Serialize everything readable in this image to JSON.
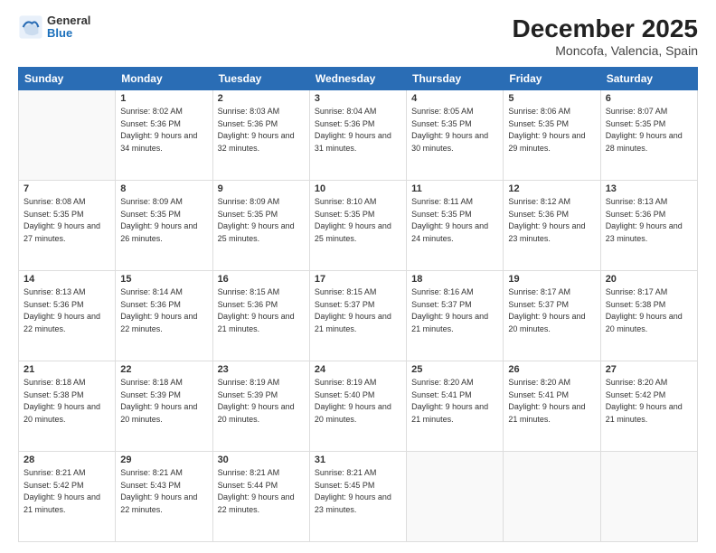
{
  "logo": {
    "general": "General",
    "blue": "Blue"
  },
  "title": "December 2025",
  "subtitle": "Moncofa, Valencia, Spain",
  "days_header": [
    "Sunday",
    "Monday",
    "Tuesday",
    "Wednesday",
    "Thursday",
    "Friday",
    "Saturday"
  ],
  "weeks": [
    [
      {
        "day": "",
        "sunrise": "",
        "sunset": "",
        "daylight": ""
      },
      {
        "day": "1",
        "sunrise": "Sunrise: 8:02 AM",
        "sunset": "Sunset: 5:36 PM",
        "daylight": "Daylight: 9 hours and 34 minutes."
      },
      {
        "day": "2",
        "sunrise": "Sunrise: 8:03 AM",
        "sunset": "Sunset: 5:36 PM",
        "daylight": "Daylight: 9 hours and 32 minutes."
      },
      {
        "day": "3",
        "sunrise": "Sunrise: 8:04 AM",
        "sunset": "Sunset: 5:36 PM",
        "daylight": "Daylight: 9 hours and 31 minutes."
      },
      {
        "day": "4",
        "sunrise": "Sunrise: 8:05 AM",
        "sunset": "Sunset: 5:35 PM",
        "daylight": "Daylight: 9 hours and 30 minutes."
      },
      {
        "day": "5",
        "sunrise": "Sunrise: 8:06 AM",
        "sunset": "Sunset: 5:35 PM",
        "daylight": "Daylight: 9 hours and 29 minutes."
      },
      {
        "day": "6",
        "sunrise": "Sunrise: 8:07 AM",
        "sunset": "Sunset: 5:35 PM",
        "daylight": "Daylight: 9 hours and 28 minutes."
      }
    ],
    [
      {
        "day": "7",
        "sunrise": "Sunrise: 8:08 AM",
        "sunset": "Sunset: 5:35 PM",
        "daylight": "Daylight: 9 hours and 27 minutes."
      },
      {
        "day": "8",
        "sunrise": "Sunrise: 8:09 AM",
        "sunset": "Sunset: 5:35 PM",
        "daylight": "Daylight: 9 hours and 26 minutes."
      },
      {
        "day": "9",
        "sunrise": "Sunrise: 8:09 AM",
        "sunset": "Sunset: 5:35 PM",
        "daylight": "Daylight: 9 hours and 25 minutes."
      },
      {
        "day": "10",
        "sunrise": "Sunrise: 8:10 AM",
        "sunset": "Sunset: 5:35 PM",
        "daylight": "Daylight: 9 hours and 25 minutes."
      },
      {
        "day": "11",
        "sunrise": "Sunrise: 8:11 AM",
        "sunset": "Sunset: 5:35 PM",
        "daylight": "Daylight: 9 hours and 24 minutes."
      },
      {
        "day": "12",
        "sunrise": "Sunrise: 8:12 AM",
        "sunset": "Sunset: 5:36 PM",
        "daylight": "Daylight: 9 hours and 23 minutes."
      },
      {
        "day": "13",
        "sunrise": "Sunrise: 8:13 AM",
        "sunset": "Sunset: 5:36 PM",
        "daylight": "Daylight: 9 hours and 23 minutes."
      }
    ],
    [
      {
        "day": "14",
        "sunrise": "Sunrise: 8:13 AM",
        "sunset": "Sunset: 5:36 PM",
        "daylight": "Daylight: 9 hours and 22 minutes."
      },
      {
        "day": "15",
        "sunrise": "Sunrise: 8:14 AM",
        "sunset": "Sunset: 5:36 PM",
        "daylight": "Daylight: 9 hours and 22 minutes."
      },
      {
        "day": "16",
        "sunrise": "Sunrise: 8:15 AM",
        "sunset": "Sunset: 5:36 PM",
        "daylight": "Daylight: 9 hours and 21 minutes."
      },
      {
        "day": "17",
        "sunrise": "Sunrise: 8:15 AM",
        "sunset": "Sunset: 5:37 PM",
        "daylight": "Daylight: 9 hours and 21 minutes."
      },
      {
        "day": "18",
        "sunrise": "Sunrise: 8:16 AM",
        "sunset": "Sunset: 5:37 PM",
        "daylight": "Daylight: 9 hours and 21 minutes."
      },
      {
        "day": "19",
        "sunrise": "Sunrise: 8:17 AM",
        "sunset": "Sunset: 5:37 PM",
        "daylight": "Daylight: 9 hours and 20 minutes."
      },
      {
        "day": "20",
        "sunrise": "Sunrise: 8:17 AM",
        "sunset": "Sunset: 5:38 PM",
        "daylight": "Daylight: 9 hours and 20 minutes."
      }
    ],
    [
      {
        "day": "21",
        "sunrise": "Sunrise: 8:18 AM",
        "sunset": "Sunset: 5:38 PM",
        "daylight": "Daylight: 9 hours and 20 minutes."
      },
      {
        "day": "22",
        "sunrise": "Sunrise: 8:18 AM",
        "sunset": "Sunset: 5:39 PM",
        "daylight": "Daylight: 9 hours and 20 minutes."
      },
      {
        "day": "23",
        "sunrise": "Sunrise: 8:19 AM",
        "sunset": "Sunset: 5:39 PM",
        "daylight": "Daylight: 9 hours and 20 minutes."
      },
      {
        "day": "24",
        "sunrise": "Sunrise: 8:19 AM",
        "sunset": "Sunset: 5:40 PM",
        "daylight": "Daylight: 9 hours and 20 minutes."
      },
      {
        "day": "25",
        "sunrise": "Sunrise: 8:20 AM",
        "sunset": "Sunset: 5:41 PM",
        "daylight": "Daylight: 9 hours and 21 minutes."
      },
      {
        "day": "26",
        "sunrise": "Sunrise: 8:20 AM",
        "sunset": "Sunset: 5:41 PM",
        "daylight": "Daylight: 9 hours and 21 minutes."
      },
      {
        "day": "27",
        "sunrise": "Sunrise: 8:20 AM",
        "sunset": "Sunset: 5:42 PM",
        "daylight": "Daylight: 9 hours and 21 minutes."
      }
    ],
    [
      {
        "day": "28",
        "sunrise": "Sunrise: 8:21 AM",
        "sunset": "Sunset: 5:42 PM",
        "daylight": "Daylight: 9 hours and 21 minutes."
      },
      {
        "day": "29",
        "sunrise": "Sunrise: 8:21 AM",
        "sunset": "Sunset: 5:43 PM",
        "daylight": "Daylight: 9 hours and 22 minutes."
      },
      {
        "day": "30",
        "sunrise": "Sunrise: 8:21 AM",
        "sunset": "Sunset: 5:44 PM",
        "daylight": "Daylight: 9 hours and 22 minutes."
      },
      {
        "day": "31",
        "sunrise": "Sunrise: 8:21 AM",
        "sunset": "Sunset: 5:45 PM",
        "daylight": "Daylight: 9 hours and 23 minutes."
      },
      {
        "day": "",
        "sunrise": "",
        "sunset": "",
        "daylight": ""
      },
      {
        "day": "",
        "sunrise": "",
        "sunset": "",
        "daylight": ""
      },
      {
        "day": "",
        "sunrise": "",
        "sunset": "",
        "daylight": ""
      }
    ]
  ]
}
